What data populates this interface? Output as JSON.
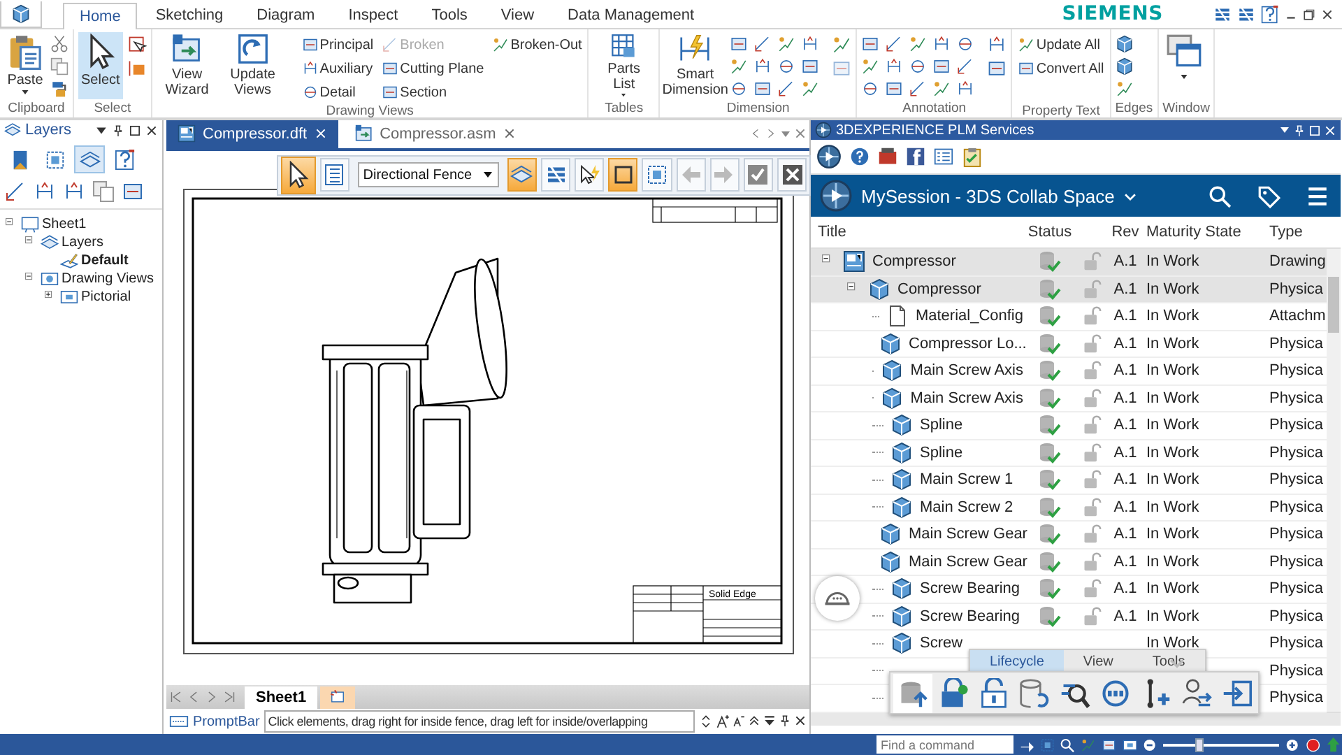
{
  "ribbon": {
    "tabs": [
      {
        "label": "Home",
        "selected": true
      },
      {
        "label": "Sketching",
        "selected": false
      },
      {
        "label": "Diagram",
        "selected": false
      },
      {
        "label": "Inspect",
        "selected": false
      },
      {
        "label": "Tools",
        "selected": false
      },
      {
        "label": "View",
        "selected": false
      },
      {
        "label": "Data Management",
        "selected": false
      }
    ],
    "brand": "SIEMENS",
    "groups": [
      {
        "kind": "clipboard",
        "label": "Clipboard",
        "buttons": [
          {
            "label": "Paste",
            "menu": true,
            "selected": false
          }
        ]
      },
      {
        "kind": "select",
        "label": "Select",
        "buttons": [
          {
            "label": "Select",
            "menu": false,
            "selected": true
          }
        ]
      },
      {
        "kind": "views",
        "label": "Drawing Views",
        "buttons": [
          {
            "label": "View Wizard",
            "menu": false,
            "selected": false
          },
          {
            "label": "Update Views",
            "menu": false,
            "selected": false
          }
        ],
        "commands": [
          {
            "label": "Principal",
            "disabled": false
          },
          {
            "label": "Auxiliary",
            "disabled": false
          },
          {
            "label": "Detail",
            "disabled": false
          },
          {
            "label": "Broken",
            "disabled": true
          },
          {
            "label": "Cutting Plane",
            "disabled": false
          },
          {
            "label": "Section",
            "disabled": false
          },
          {
            "label": "Broken-Out",
            "disabled": false
          }
        ]
      },
      {
        "kind": "tables",
        "label": "Tables",
        "buttons": [
          {
            "label": "Parts List",
            "menu": true,
            "selected": false
          }
        ]
      },
      {
        "kind": "dimension",
        "label": "Dimension",
        "buttons": [
          {
            "label": "Smart Dimension",
            "menu": false,
            "selected": false
          }
        ]
      },
      {
        "kind": "annotation",
        "label": "Annotation"
      },
      {
        "kind": "property",
        "label": "Property Text",
        "commands": [
          {
            "label": "Update All",
            "disabled": false
          },
          {
            "label": "Convert All",
            "disabled": false
          }
        ]
      },
      {
        "kind": "edges",
        "label": "Edges"
      },
      {
        "kind": "window",
        "label": "Window",
        "buttons": [
          {
            "menu": true,
            "selected": false
          }
        ]
      }
    ]
  },
  "layers_pane": {
    "title": "Layers",
    "tabs": [
      {
        "kind": "book",
        "selected": false
      },
      {
        "kind": "frame",
        "selected": false
      },
      {
        "kind": "layers",
        "selected": true
      },
      {
        "kind": "help",
        "selected": false
      }
    ],
    "tree": [
      {
        "label": "Sheet1",
        "kind": "sheet",
        "expanded": true,
        "children": [
          {
            "label": "Layers",
            "kind": "layers",
            "expanded": true,
            "children": [
              {
                "label": "Default",
                "kind": "layer",
                "active": true
              }
            ]
          },
          {
            "label": "Drawing Views",
            "kind": "views",
            "expanded": true,
            "children": [
              {
                "label": "Pictorial",
                "kind": "view",
                "expanded": false
              }
            ]
          }
        ]
      }
    ]
  },
  "documents": {
    "tabs": [
      {
        "label": "Compressor.dft",
        "kind": "draft",
        "selected": true
      },
      {
        "label": "Compressor.asm",
        "kind": "assembly",
        "selected": false
      }
    ],
    "command_bar": [
      {
        "kind": "pointer",
        "on": true
      },
      {
        "kind": "list",
        "on": false
      },
      {
        "kind": "dropdown",
        "value": "Directional Fence"
      },
      {
        "kind": "layers-down",
        "on": true
      },
      {
        "kind": "layers-up",
        "on": false
      },
      {
        "kind": "lightning",
        "on": false
      },
      {
        "kind": "rect-fence",
        "on": true
      },
      {
        "kind": "corner-fence",
        "on": false
      },
      {
        "kind": "back",
        "disabled": true
      },
      {
        "kind": "forward",
        "disabled": true
      },
      {
        "kind": "accept"
      },
      {
        "kind": "cancel"
      }
    ],
    "title_block": "Solid Edge",
    "sheet_tabs": [
      {
        "label": "Sheet1",
        "selected": true
      }
    ],
    "prompt_bar": {
      "label": "PromptBar",
      "message": "Click elements, drag right for inside fence, drag left for inside/overlapping"
    }
  },
  "plm": {
    "title": "3DEXPERIENCE PLM Services",
    "session": "MySession - 3DS Collab Space",
    "columns": [
      {
        "kind": "title",
        "label": "Title"
      },
      {
        "kind": "status",
        "label": "Status"
      },
      {
        "kind": "lock"
      },
      {
        "kind": "rev",
        "label": "Rev"
      },
      {
        "kind": "maturity",
        "label": "Maturity State"
      },
      {
        "kind": "type",
        "label": "Type"
      }
    ],
    "rows": [
      {
        "title": "Compressor",
        "kind": "drawing",
        "synced": true,
        "rev": "A.1",
        "maturity": "In Work",
        "type": "Drawing",
        "selected": true,
        "expanded": true,
        "children": [
          {
            "title": "Compressor",
            "kind": "part",
            "synced": true,
            "rev": "A.1",
            "maturity": "In Work",
            "type": "Physica",
            "selected": true,
            "expanded": true,
            "children": [
              {
                "title": "Material_Config",
                "kind": "document",
                "synced": true,
                "rev": "A.1",
                "maturity": "In Work",
                "type": "Attachm",
                "selected": false
              },
              {
                "title": "Compressor Lo...",
                "kind": "part",
                "synced": true,
                "rev": "A.1",
                "maturity": "In Work",
                "type": "Physica",
                "selected": false
              },
              {
                "title": "Main Screw Axis",
                "kind": "part",
                "synced": true,
                "rev": "A.1",
                "maturity": "In Work",
                "type": "Physica",
                "selected": false
              },
              {
                "title": "Main Screw Axis",
                "kind": "part",
                "synced": true,
                "rev": "A.1",
                "maturity": "In Work",
                "type": "Physica",
                "selected": false
              },
              {
                "title": "Spline",
                "kind": "part",
                "synced": true,
                "rev": "A.1",
                "maturity": "In Work",
                "type": "Physica",
                "selected": false
              },
              {
                "title": "Spline",
                "kind": "part",
                "synced": true,
                "rev": "A.1",
                "maturity": "In Work",
                "type": "Physica",
                "selected": false
              },
              {
                "title": "Main Screw 1",
                "kind": "part",
                "synced": true,
                "rev": "A.1",
                "maturity": "In Work",
                "type": "Physica",
                "selected": false
              },
              {
                "title": "Main Screw 2",
                "kind": "part",
                "synced": true,
                "rev": "A.1",
                "maturity": "In Work",
                "type": "Physica",
                "selected": false
              },
              {
                "title": "Main Screw Gear",
                "kind": "part",
                "synced": true,
                "rev": "A.1",
                "maturity": "In Work",
                "type": "Physica",
                "selected": false
              },
              {
                "title": "Main Screw Gear",
                "kind": "part",
                "synced": true,
                "rev": "A.1",
                "maturity": "In Work",
                "type": "Physica",
                "selected": false
              },
              {
                "title": "Screw Bearing",
                "kind": "part",
                "synced": true,
                "rev": "A.1",
                "maturity": "In Work",
                "type": "Physica",
                "selected": false
              },
              {
                "title": "Screw Bearing",
                "kind": "part",
                "synced": true,
                "rev": "A.1",
                "maturity": "In Work",
                "type": "Physica",
                "selected": false
              },
              {
                "title": "Screw",
                "kind": "part",
                "synced": false,
                "maturity": "In Work",
                "type": "Physica",
                "selected": false
              },
              {
                "synced": false,
                "type": "Physica",
                "selected": false
              },
              {
                "synced": false,
                "type": "Physica",
                "selected": false
              }
            ]
          }
        ]
      }
    ],
    "action_bar": {
      "tabs": [
        {
          "label": "Lifecycle",
          "selected": true
        },
        {
          "label": "View",
          "selected": false
        },
        {
          "label": "Tools",
          "selected": false
        }
      ],
      "actions": [
        {
          "kind": "db-stack",
          "selected": true
        },
        {
          "kind": "lock-key",
          "selected": false
        },
        {
          "kind": "unlock",
          "selected": false
        },
        {
          "kind": "db-refresh",
          "selected": false
        },
        {
          "kind": "search-arrow",
          "selected": false
        },
        {
          "kind": "cycle",
          "selected": false
        },
        {
          "kind": "add-link",
          "selected": false
        },
        {
          "kind": "user-swap",
          "selected": false
        },
        {
          "kind": "enter",
          "selected": false
        }
      ]
    }
  },
  "status_bar": {
    "search": {
      "placeholder": "Find a command"
    },
    "zoom": {
      "level": 0.31
    }
  }
}
